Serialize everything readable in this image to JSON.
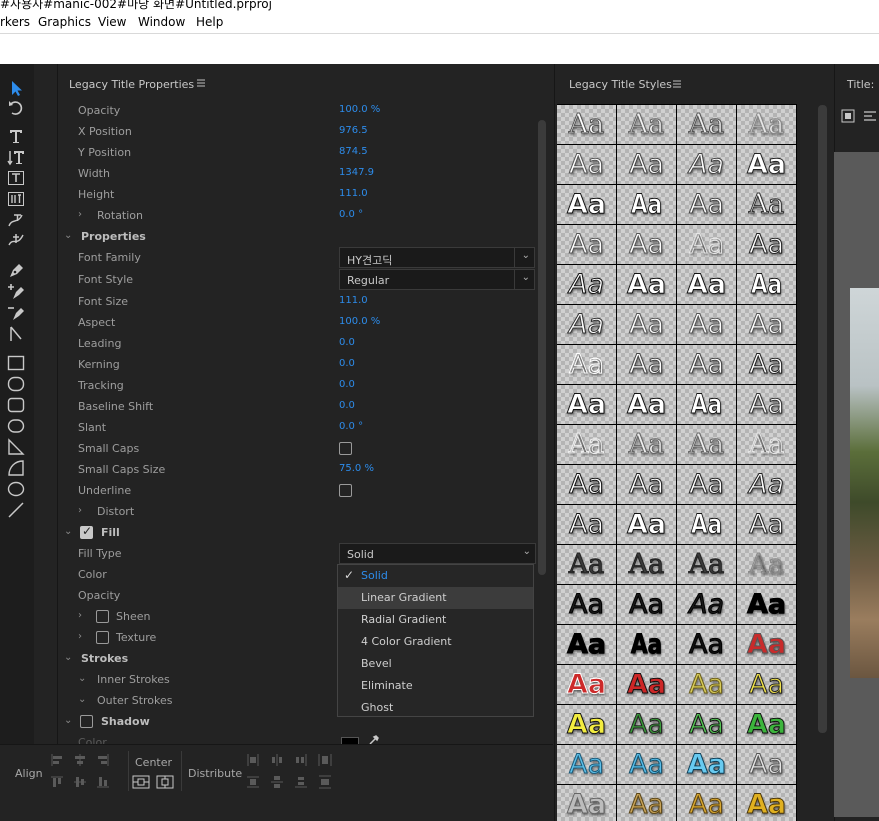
{
  "window": {
    "path_fragment": "#사용자#manic-002#마당 화면#Untitled.prproj"
  },
  "menu": [
    "rkers",
    "Graphics",
    "View",
    "Window",
    "Help"
  ],
  "properties_panel": {
    "title": "Legacy Title Properties",
    "menu_icon": "hamburger-icon",
    "rows": [
      {
        "label": "Opacity",
        "value": "100.0 %"
      },
      {
        "label": "X Position",
        "value": "976.5"
      },
      {
        "label": "Y Position",
        "value": "874.5"
      },
      {
        "label": "Width",
        "value": "1347.9"
      },
      {
        "label": "Height",
        "value": "111.0"
      },
      {
        "label": "Rotation",
        "value": "0.0 °"
      },
      {
        "label": "Properties"
      },
      {
        "label": "Font Family",
        "value": "HY견고딕"
      },
      {
        "label": "Font Style",
        "value": "Regular"
      },
      {
        "label": "Font Size",
        "value": "111.0"
      },
      {
        "label": "Aspect",
        "value": "100.0 %"
      },
      {
        "label": "Leading",
        "value": "0.0"
      },
      {
        "label": "Kerning",
        "value": "0.0"
      },
      {
        "label": "Tracking",
        "value": "0.0"
      },
      {
        "label": "Baseline Shift",
        "value": "0.0"
      },
      {
        "label": "Slant",
        "value": "0.0 °"
      },
      {
        "label": "Small Caps",
        "checked": false
      },
      {
        "label": "Small Caps Size",
        "value": "75.0 %"
      },
      {
        "label": "Underline",
        "checked": false
      },
      {
        "label": "Distort"
      },
      {
        "label": "Fill",
        "checked": true
      },
      {
        "label": "Fill Type",
        "value": "Solid"
      },
      {
        "label": "Color"
      },
      {
        "label": "Opacity"
      },
      {
        "label": "Sheen",
        "checked": false
      },
      {
        "label": "Texture",
        "checked": false
      },
      {
        "label": "Strokes"
      },
      {
        "label": "Inner Strokes"
      },
      {
        "label": "Outer Strokes"
      },
      {
        "label": "Shadow",
        "checked": false
      },
      {
        "label": "Color"
      }
    ]
  },
  "fill_type_dropdown": {
    "selected": "Solid",
    "highlighted": "Linear Gradient",
    "options": [
      "Solid",
      "Linear Gradient",
      "Radial Gradient",
      "4 Color Gradient",
      "Bevel",
      "Eliminate",
      "Ghost"
    ]
  },
  "bottom_bar": {
    "align_label": "Align",
    "center_label": "Center",
    "distribute_label": "Distribute"
  },
  "styles_panel": {
    "title": "Legacy Title Styles",
    "menu_icon": "hamburger-icon",
    "swatch_text": "Aa",
    "swatches": [
      {
        "fill": "#ffffff",
        "stroke": "#555555",
        "font": "serif"
      },
      {
        "fill": "#f2f2f2",
        "stroke": "#666666",
        "font": "serif"
      },
      {
        "fill": "#eeeeee",
        "stroke": "#555555",
        "font": "serif"
      },
      {
        "fill": "#e6e6e6",
        "stroke": "#888888",
        "font": "serif"
      },
      {
        "fill": "#ffffff",
        "stroke": "#555555",
        "font": "sans"
      },
      {
        "fill": "#ffffff",
        "stroke": "#444444",
        "font": "sans"
      },
      {
        "fill": "#ffffff",
        "stroke": "#444444",
        "font": "sans",
        "italic": true
      },
      {
        "fill": "#ffffff",
        "stroke": "#222222",
        "font": "sans",
        "bold": true
      },
      {
        "fill": "#ffffff",
        "stroke": "#111111",
        "font": "sans",
        "bold": true
      },
      {
        "fill": "#ffffff",
        "stroke": "#111111",
        "font": "sans",
        "bold": true,
        "condensed": true
      },
      {
        "fill": "#ffffff",
        "stroke": "#444444",
        "font": "sans"
      },
      {
        "fill": "#ffffff",
        "stroke": "#333333",
        "font": "serif"
      },
      {
        "fill": "#ffffff",
        "stroke": "#555555",
        "font": "sans"
      },
      {
        "fill": "#ffffff",
        "stroke": "#555555",
        "font": "sans"
      },
      {
        "fill": "#e8e8e8",
        "stroke": "#777777",
        "font": "sans",
        "outline": true
      },
      {
        "fill": "#ffffff",
        "stroke": "#222222",
        "font": "sans"
      },
      {
        "fill": "#ffffff",
        "stroke": "#111111",
        "font": "sans",
        "italic": true
      },
      {
        "fill": "#ffffff",
        "stroke": "#111111",
        "font": "sans",
        "bold": true
      },
      {
        "fill": "#ffffff",
        "stroke": "#111111",
        "font": "sans",
        "bold": true
      },
      {
        "fill": "#ffffff",
        "stroke": "#111111",
        "font": "sans",
        "bold": true,
        "condensed": true
      },
      {
        "fill": "#ffffff",
        "stroke": "#333333",
        "font": "sans",
        "italic": true
      },
      {
        "fill": "#ffffff",
        "stroke": "#555555",
        "font": "sans"
      },
      {
        "fill": "#ffffff",
        "stroke": "#555555",
        "font": "sans"
      },
      {
        "fill": "#ffffff",
        "stroke": "#555555",
        "font": "sans"
      },
      {
        "fill": "#ffffff",
        "stroke": "#555555",
        "font": "sans",
        "outline": true
      },
      {
        "fill": "#ffffff",
        "stroke": "#444444",
        "font": "sans"
      },
      {
        "fill": "#ffffff",
        "stroke": "#444444",
        "font": "sans"
      },
      {
        "fill": "#ffffff",
        "stroke": "#222222",
        "font": "sans"
      },
      {
        "fill": "#ffffff",
        "stroke": "#111111",
        "font": "sans",
        "bold": true
      },
      {
        "fill": "#ffffff",
        "stroke": "#111111",
        "font": "sans",
        "bold": true
      },
      {
        "fill": "#ffffff",
        "stroke": "#111111",
        "font": "sans",
        "bold": true,
        "condensed": true
      },
      {
        "fill": "#ffffff",
        "stroke": "#333333",
        "font": "sans"
      },
      {
        "fill": "#eeeeee",
        "stroke": "#666666",
        "font": "serif",
        "outline": true
      },
      {
        "fill": "#eeeeee",
        "stroke": "#666666",
        "font": "serif"
      },
      {
        "fill": "#eeeeee",
        "stroke": "#666666",
        "font": "serif"
      },
      {
        "fill": "#e6e6e6",
        "stroke": "#888888",
        "font": "serif",
        "outline": true
      },
      {
        "fill": "#ffffff",
        "stroke": "#111111",
        "font": "sans"
      },
      {
        "fill": "#ffffff",
        "stroke": "#222222",
        "font": "sans"
      },
      {
        "fill": "#ffffff",
        "stroke": "#222222",
        "font": "sans"
      },
      {
        "fill": "#ffffff",
        "stroke": "#222222",
        "font": "sans",
        "italic": true
      },
      {
        "fill": "#ffffff",
        "stroke": "#111111",
        "font": "sans"
      },
      {
        "fill": "#ffffff",
        "stroke": "#111111",
        "font": "sans",
        "bold": true
      },
      {
        "fill": "#ffffff",
        "stroke": "#111111",
        "font": "sans",
        "bold": true,
        "condensed": true
      },
      {
        "fill": "#ffffff",
        "stroke": "#222222",
        "font": "sans"
      },
      {
        "fill": "#3a3a3a",
        "stroke": "#222222",
        "font": "serif"
      },
      {
        "fill": "#3a3a3a",
        "stroke": "#222222",
        "font": "serif"
      },
      {
        "fill": "#3a3a3a",
        "stroke": "#222222",
        "font": "serif"
      },
      {
        "fill": "#888888",
        "stroke": "#555555",
        "font": "serif",
        "outline": true
      },
      {
        "fill": "#1a1a1a",
        "stroke": "#000000",
        "font": "sans"
      },
      {
        "fill": "#1a1a1a",
        "stroke": "#000000",
        "font": "sans"
      },
      {
        "fill": "#1a1a1a",
        "stroke": "#000000",
        "font": "sans",
        "italic": true
      },
      {
        "fill": "#000000",
        "stroke": "#000000",
        "font": "sans",
        "bold": true
      },
      {
        "fill": "#000000",
        "stroke": "#000000",
        "font": "sans",
        "bold": true
      },
      {
        "fill": "#000000",
        "stroke": "#000000",
        "font": "sans",
        "bold": true,
        "condensed": true
      },
      {
        "fill": "#111111",
        "stroke": "#000000",
        "font": "sans"
      },
      {
        "fill": "#c82b2b",
        "stroke": "#555555",
        "font": "sans",
        "bold": true
      },
      {
        "fill": "#cc2a2a",
        "stroke": "#ffffff",
        "font": "sans",
        "bold": true
      },
      {
        "fill": "#cc2626",
        "stroke": "#111111",
        "font": "sans",
        "bold": true
      },
      {
        "fill": "#d8cc5a",
        "stroke": "#6b5e1a",
        "font": "sans"
      },
      {
        "fill": "#f0e24a",
        "stroke": "#222222",
        "font": "sans"
      },
      {
        "fill": "#f2ec40",
        "stroke": "#111111",
        "font": "sans",
        "bold": true
      },
      {
        "fill": "#3a9a3a",
        "stroke": "#222222",
        "font": "sans"
      },
      {
        "fill": "#55c455",
        "stroke": "#111111",
        "font": "sans"
      },
      {
        "fill": "#3cb43c",
        "stroke": "#111111",
        "font": "sans",
        "bold": true
      },
      {
        "fill": "#5ec0e8",
        "stroke": "#1a5a7a",
        "font": "sans"
      },
      {
        "fill": "#58bce8",
        "stroke": "#14506a",
        "font": "sans"
      },
      {
        "fill": "#68caf0",
        "stroke": "#0e3f58",
        "font": "sans",
        "bold": true
      },
      {
        "fill": "#e4e4e4",
        "stroke": "#555555",
        "font": "sans"
      },
      {
        "fill": "#bcbcbc",
        "stroke": "#666666",
        "font": "sans",
        "bold": true
      },
      {
        "fill": "#c8a45a",
        "stroke": "#5a4516",
        "font": "sans"
      },
      {
        "fill": "#d8a830",
        "stroke": "#5a4212",
        "font": "sans"
      },
      {
        "fill": "#e0b020",
        "stroke": "#4a360a",
        "font": "sans",
        "bold": true
      }
    ]
  },
  "title_panel": {
    "label": "Title: "
  }
}
